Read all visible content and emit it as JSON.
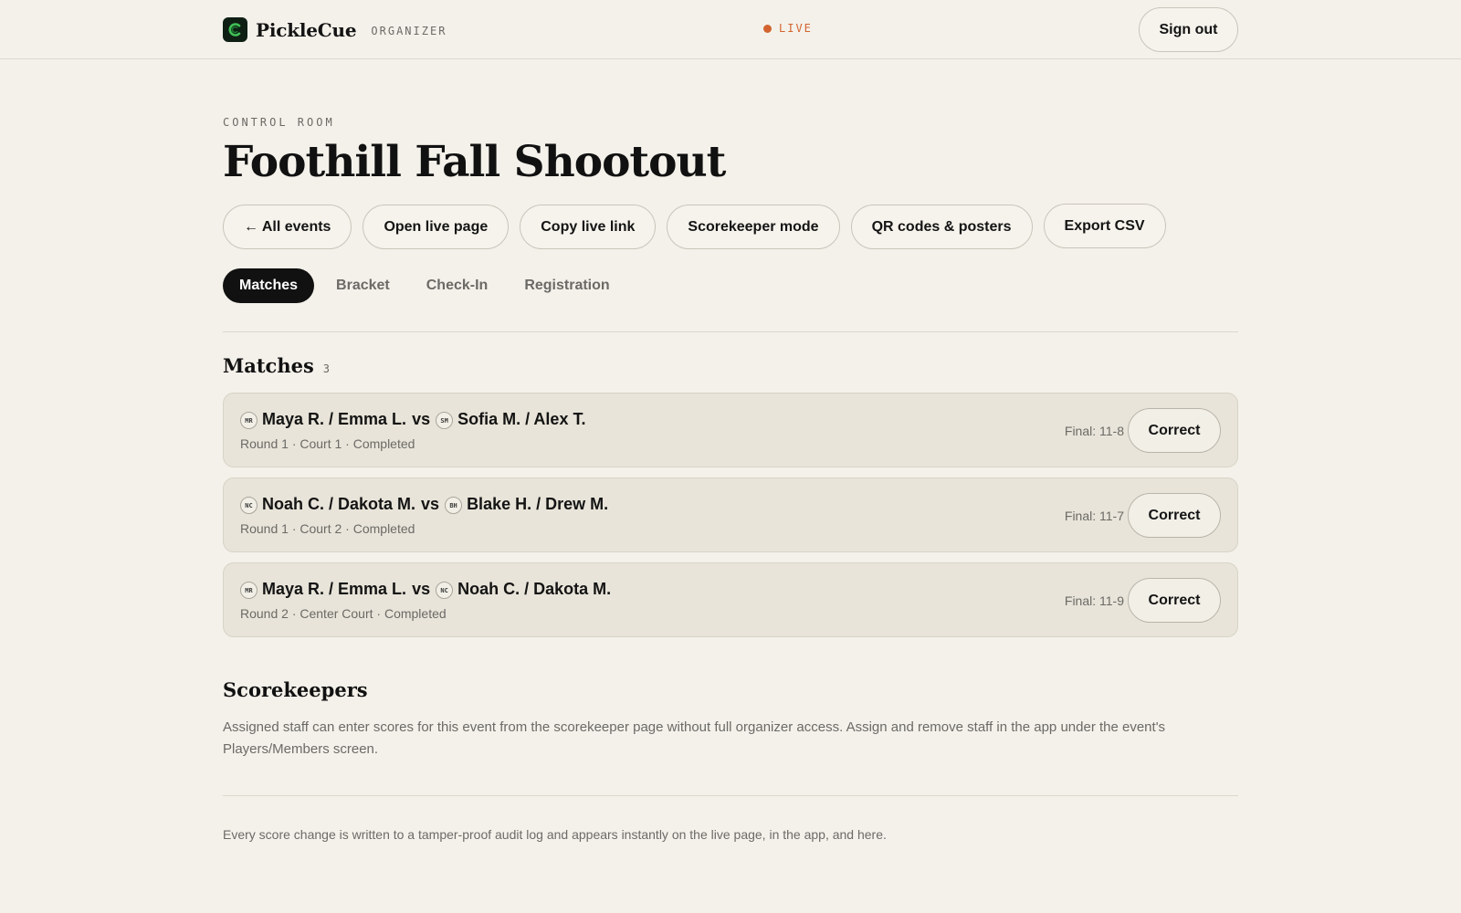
{
  "header": {
    "brand": "PickleCue",
    "tag": "ORGANIZER",
    "live_label": "LIVE",
    "sign_out_label": "Sign out"
  },
  "page": {
    "eyebrow": "CONTROL ROOM",
    "title": "Foothill Fall Shootout"
  },
  "actions": [
    {
      "label": "← All events"
    },
    {
      "label": "Open live page"
    },
    {
      "label": "Copy live link"
    },
    {
      "label": "Scorekeeper mode"
    },
    {
      "label": "QR codes & posters"
    },
    {
      "label": "Export CSV"
    }
  ],
  "tabs": [
    {
      "label": "Matches",
      "active": true
    },
    {
      "label": "Bracket",
      "active": false
    },
    {
      "label": "Check-In",
      "active": false
    },
    {
      "label": "Registration",
      "active": false
    }
  ],
  "matches_section": {
    "title": "Matches",
    "count": "3",
    "items": [
      {
        "team1_initials": "MR",
        "team1": "Maya R. / Emma L.",
        "vs": "vs",
        "team2_initials": "SM",
        "team2": "Sofia M. / Alex T.",
        "meta": "Round 1 · Court 1 · Completed",
        "final": "Final: 11-8",
        "action": "Correct"
      },
      {
        "team1_initials": "NC",
        "team1": "Noah C. / Dakota M.",
        "vs": "vs",
        "team2_initials": "BH",
        "team2": "Blake H. / Drew M.",
        "meta": "Round 1 · Court 2 · Completed",
        "final": "Final: 11-7",
        "action": "Correct"
      },
      {
        "team1_initials": "MR",
        "team1": "Maya R. / Emma L.",
        "vs": "vs",
        "team2_initials": "NC",
        "team2": "Noah C. / Dakota M.",
        "meta": "Round 2 · Center Court · Completed",
        "final": "Final: 11-9",
        "action": "Correct"
      }
    ]
  },
  "scorekeepers": {
    "title": "Scorekeepers",
    "description": "Assigned staff can enter scores for this event from the scorekeeper page without full organizer access. Assign and remove staff in the app under the event's Players/Members screen."
  },
  "footer_note": "Every score change is written to a tamper-proof audit log and appears instantly on the live page, in the app, and here.",
  "colors": {
    "background": "#f4f1ea",
    "accent_live": "#d3642f",
    "active_tab": "#111111",
    "card": "#e8e4d9",
    "logo": "#0f1f14",
    "logo_mark": "#3fbf55"
  }
}
